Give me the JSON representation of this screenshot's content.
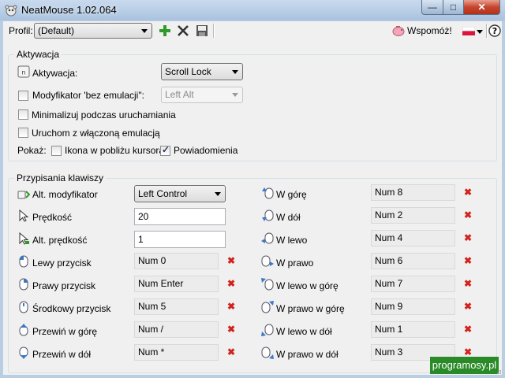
{
  "window": {
    "title": "NeatMouse 1.02.064",
    "min_symbol": "—",
    "max_symbol": "□",
    "close_symbol": "✕"
  },
  "toolbar": {
    "profile_label": "Profil:",
    "profile_value": "(Default)",
    "donate_label": "Wspomóż!",
    "icons": [
      "add-icon",
      "delete-icon",
      "save-icon",
      "piggy-bank-icon",
      "poland-flag-icon"
    ]
  },
  "activation": {
    "group_title": "Aktywacja",
    "activation_label": "Aktywacja:",
    "activation_value": "Scroll Lock",
    "modifier_label": "Modyfikator 'bez emulacji\":",
    "modifier_value": "Left Alt",
    "modifier_checked": false,
    "minimize_label": "Minimalizuj podczas uruchamiania",
    "minimize_checked": false,
    "start_label": "Uruchom z włączoną emulacją",
    "start_checked": false,
    "show_label": "Pokaż:",
    "cursor_icon_label": "Ikona w pobliżu kursora",
    "cursor_icon_checked": false,
    "notifications_label": "Powiadomienia",
    "notifications_checked": true
  },
  "bindings": {
    "group_title": "Przypisania klawiszy",
    "alt_modifier_label": "Alt. modyfikator",
    "alt_modifier_value": "Left Control",
    "speed_label": "Prędkość",
    "speed_value": "20",
    "alt_speed_label": "Alt. prędkość",
    "alt_speed_value": "1",
    "left": [
      {
        "label": "Lewy przycisk",
        "key": "Num 0"
      },
      {
        "label": "Prawy przycisk",
        "key": "Num Enter"
      },
      {
        "label": "Środkowy przycisk",
        "key": "Num 5"
      },
      {
        "label": "Przewiń w górę",
        "key": "Num /"
      },
      {
        "label": "Przewiń w dół",
        "key": "Num *"
      }
    ],
    "right": [
      {
        "label": "W górę",
        "key": "Num 8"
      },
      {
        "label": "W dół",
        "key": "Num 2"
      },
      {
        "label": "W lewo",
        "key": "Num 4"
      },
      {
        "label": "W prawo",
        "key": "Num 6"
      },
      {
        "label": "W lewo w górę",
        "key": "Num 7"
      },
      {
        "label": "W prawo w górę",
        "key": "Num 9"
      },
      {
        "label": "W lewo w dół",
        "key": "Num 1"
      },
      {
        "label": "W prawo w dół",
        "key": "Num 3"
      }
    ],
    "clear_symbol": "✖"
  },
  "watermark": "programosy.pl"
}
